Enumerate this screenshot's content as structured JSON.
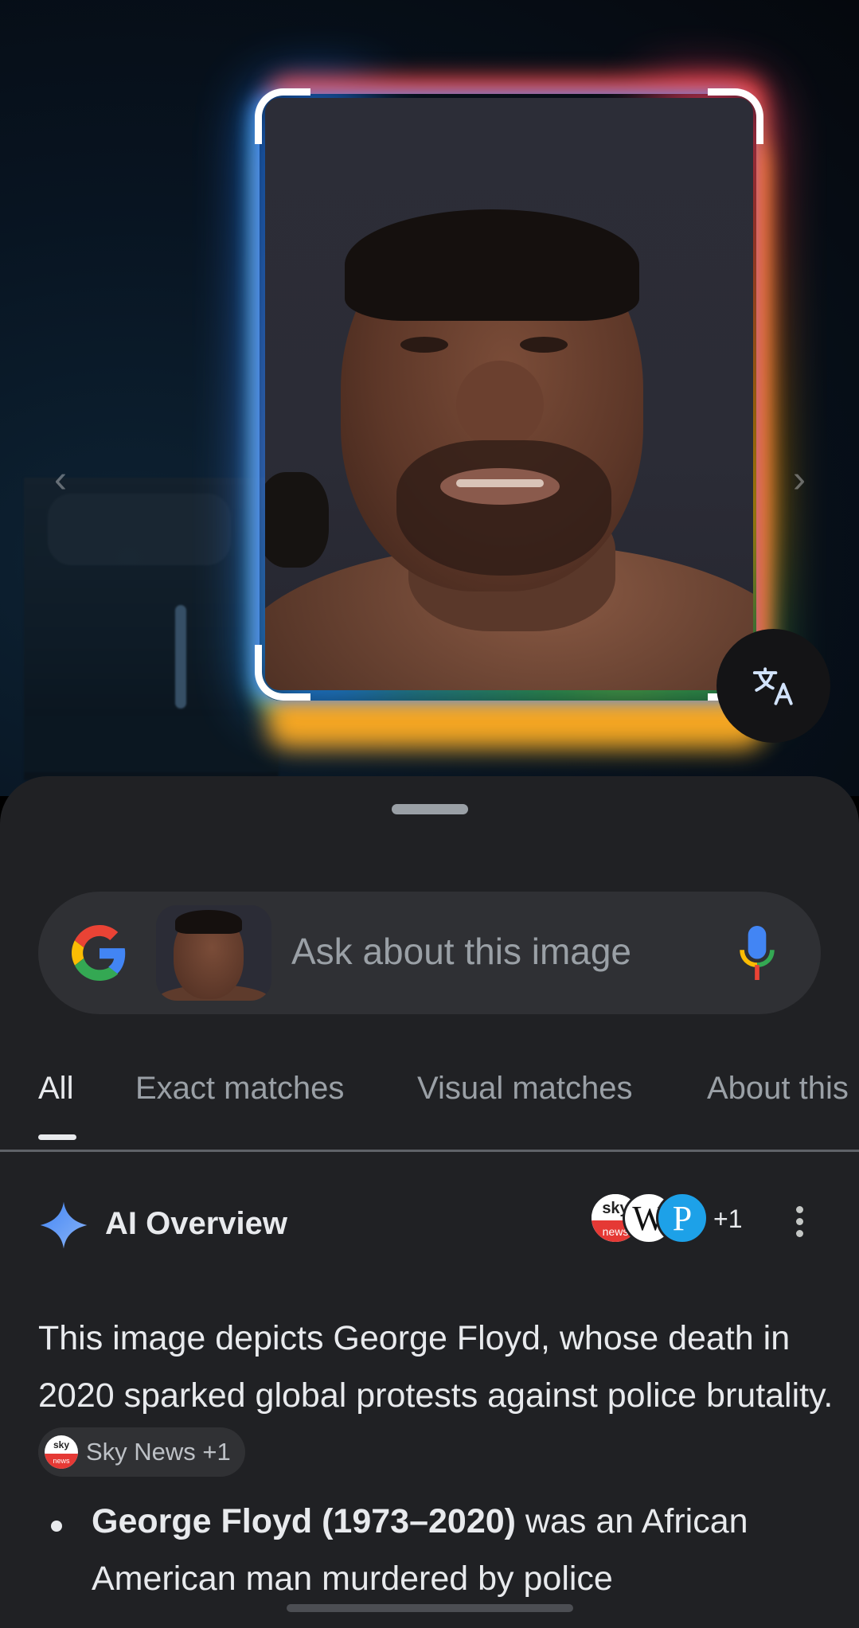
{
  "viewer": {
    "prev_arrow": "‹",
    "next_arrow": "›",
    "translate_icon": "translate-icon"
  },
  "search": {
    "placeholder": "Ask about this image",
    "logo_icon": "google-g-icon",
    "mic_icon": "microphone-icon"
  },
  "tabs": [
    {
      "label": "All",
      "active": true
    },
    {
      "label": "Exact matches",
      "active": false
    },
    {
      "label": "Visual matches",
      "active": false
    },
    {
      "label": "About this",
      "active": false
    }
  ],
  "ai_overview": {
    "title": "AI Overview",
    "sources": [
      {
        "name": "Sky News",
        "icon": "sky-news-icon",
        "label_top": "sky",
        "label_bottom": "news"
      },
      {
        "name": "Wikipedia",
        "icon": "wikipedia-icon",
        "label": "W"
      },
      {
        "name": "WordPress",
        "icon": "wordpress-icon",
        "label": "P"
      }
    ],
    "extra_sources": "+1",
    "summary": "This image depicts George Floyd, whose death in 2020 sparked global protests against police brutality.",
    "citation_chip": "Sky News +1",
    "bullet_bold": "George Floyd (1973–2020)",
    "bullet_text": " was an African American man murdered by police"
  },
  "colors": {
    "sheet_bg": "#202124",
    "search_bg": "#2f3034",
    "text_primary": "#e8eaed",
    "text_secondary": "#9aa0a6",
    "google_blue": "#4285f4",
    "google_red": "#ea4335",
    "google_yellow": "#fbbc04",
    "google_green": "#34a853"
  }
}
